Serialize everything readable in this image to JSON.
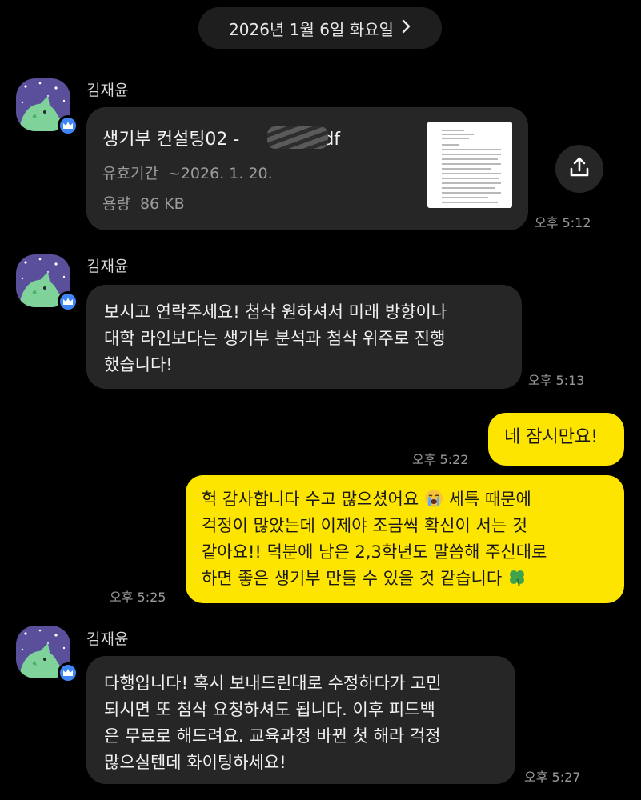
{
  "date_divider": {
    "label": "2026년 1월 6일 화요일"
  },
  "messages": {
    "file": {
      "sender": "김재윤",
      "file_name_prefix": "생기부 컨설팅02 -",
      "file_name_suffix": "pdf",
      "expiry_label": "유효기간",
      "expiry_value": "~2026. 1. 20.",
      "size_label": "용량",
      "size_value": "86 KB",
      "time": "오후 5:12"
    },
    "m2": {
      "sender": "김재윤",
      "text": "보시고 연락주세요! 첨삭 원하셔서 미래 방향이나\n대학 라인보다는 생기부 분석과 첨삭 위주로 진행\n했습니다!",
      "time": "오후 5:13"
    },
    "m3": {
      "text": "네 잠시만요!",
      "time": "오후 5:22"
    },
    "m4": {
      "text_1": "헉 감사합니다 수고 많으셨어요",
      "text_2": " 세특 때문에\n걱정이 많았는데 이제야 조금씩 확신이 서는 것\n같아요!! 덕분에 남은 2,3학년도 말씀해 주신대로\n하면 좋은 생기부 만들 수 있을 것 같습니다",
      "emoji_1": "loudly-crying-face",
      "emoji_2": "four-leaf-clover",
      "time": "오후 5:25"
    },
    "m5": {
      "sender": "김재윤",
      "text": "다행입니다! 혹시 보내드린대로 수정하다가 고민\n되시면 또 첨삭 요청하셔도 됩니다. 이후 피드백\n은 무료로 해드려요. 교육과정 바뀐 첫 해라 걱정\n많으실텐데 화이팅하세요!",
      "time": "오후 5:27"
    }
  },
  "colors": {
    "background": "#000000",
    "incoming_bubble": "#262626",
    "outgoing_bubble": "#fee500",
    "badge": "#3e86f5"
  },
  "icons": {
    "share": "share-upload-icon",
    "chevron": "chevron-right-icon",
    "badge": "crown-icon"
  }
}
